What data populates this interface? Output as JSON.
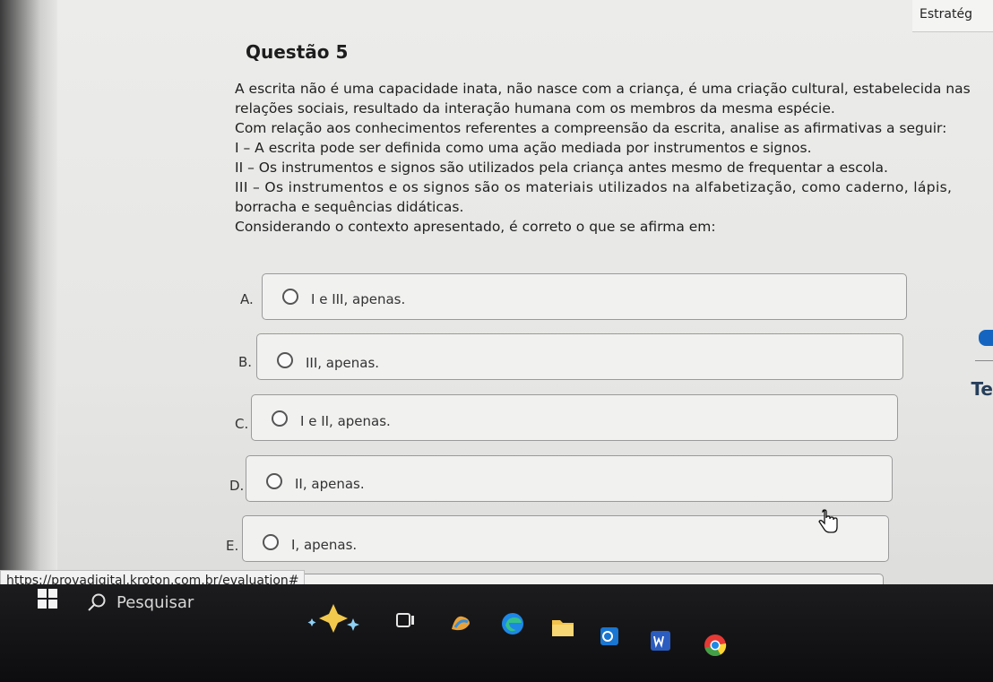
{
  "browser": {
    "tab_title": "Estratég"
  },
  "question": {
    "title": "Questão 5",
    "lines": [
      "A escrita não é uma capacidade inata, não nasce com a criança, é uma criação cultural, estabelecida nas",
      "relações sociais, resultado da interação humana com os membros da mesma espécie.",
      "Com relação aos conhecimentos referentes a compreensão da escrita, analise as afirmativas a seguir:",
      "I – A escrita pode ser definida como uma ação mediada por instrumentos e signos.",
      "II – Os instrumentos e signos são utilizados pela criança antes mesmo de frequentar a escola.",
      "III – Os instrumentos e os signos são os materiais utilizados na alfabetização, como caderno, lápis,",
      "borracha e sequências didáticas.",
      "Considerando o contexto apresentado, é correto o que se afirma em:"
    ]
  },
  "options": [
    {
      "letter": "A.",
      "text": "I e III, apenas."
    },
    {
      "letter": "B.",
      "text": "III, apenas."
    },
    {
      "letter": "C.",
      "text": "I e II, apenas."
    },
    {
      "letter": "D.",
      "text": "II, apenas."
    },
    {
      "letter": "E.",
      "text": "I, apenas."
    }
  ],
  "status_bar": {
    "url": "https://provadigital.kroton.com.br/evaluation#"
  },
  "side_panel": {
    "partial_label": "Te"
  },
  "taskbar": {
    "search_placeholder": "Pesquisar",
    "icons": [
      "copilot-icon",
      "task-view-icon",
      "widgets-icon",
      "edge-icon",
      "file-explorer-icon",
      "outlook-icon",
      "word-icon",
      "chrome-icon"
    ]
  },
  "colors": {
    "taskbar": "#111111",
    "page_background": "#e8e8e6",
    "accent_blue": "#1565c0"
  }
}
